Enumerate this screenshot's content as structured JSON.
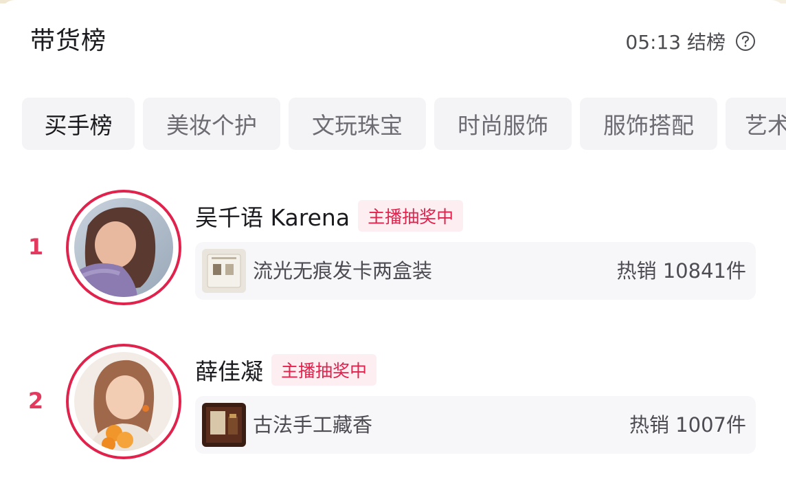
{
  "header": {
    "title": "带货榜",
    "countdown": "05:13 结榜",
    "help_icon": "question-circle-icon"
  },
  "tabs": [
    {
      "label": "买手榜",
      "active": true
    },
    {
      "label": "美妆个护",
      "active": false
    },
    {
      "label": "文玩珠宝",
      "active": false
    },
    {
      "label": "时尚服饰",
      "active": false
    },
    {
      "label": "服饰搭配",
      "active": false
    },
    {
      "label": "艺术",
      "active": false
    }
  ],
  "rankings": [
    {
      "rank": "1",
      "name": "吴千语 Karena",
      "badge": "主播抽奖中",
      "product": "流光无痕发卡两盒装",
      "sales": "热销 10841件"
    },
    {
      "rank": "2",
      "name": "薛佳凝",
      "badge": "主播抽奖中",
      "product": "古法手工藏香",
      "sales": "热销 1007件"
    }
  ],
  "colors": {
    "accent": "#e0234d",
    "rank": "#e23a5f",
    "badge_bg": "#fdeef1",
    "tab_bg": "#f4f4f6",
    "card_bg": "#f7f7f9"
  }
}
